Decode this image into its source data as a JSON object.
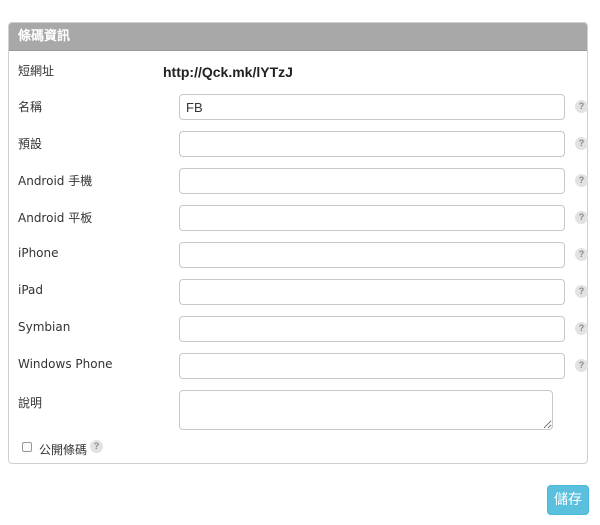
{
  "panel": {
    "title": "條碼資訊"
  },
  "short_url": {
    "label": "短網址",
    "value": "http://Qck.mk/lYTzJ"
  },
  "fields": [
    {
      "label": "名稱",
      "value": "FB"
    },
    {
      "label": "預設",
      "value": ""
    },
    {
      "label": "Android 手機",
      "value": ""
    },
    {
      "label": "Android 平板",
      "value": ""
    },
    {
      "label": "iPhone",
      "value": ""
    },
    {
      "label": "iPad",
      "value": ""
    },
    {
      "label": "Symbian",
      "value": ""
    },
    {
      "label": "Windows Phone",
      "value": ""
    }
  ],
  "description": {
    "label": "說明",
    "value": ""
  },
  "public": {
    "label": "公開條碼",
    "checked": false
  },
  "help_glyph": "?",
  "save_button": {
    "label": "儲存"
  },
  "colors": {
    "header": "#a8a8a8",
    "save_button": "#5bc0de"
  }
}
